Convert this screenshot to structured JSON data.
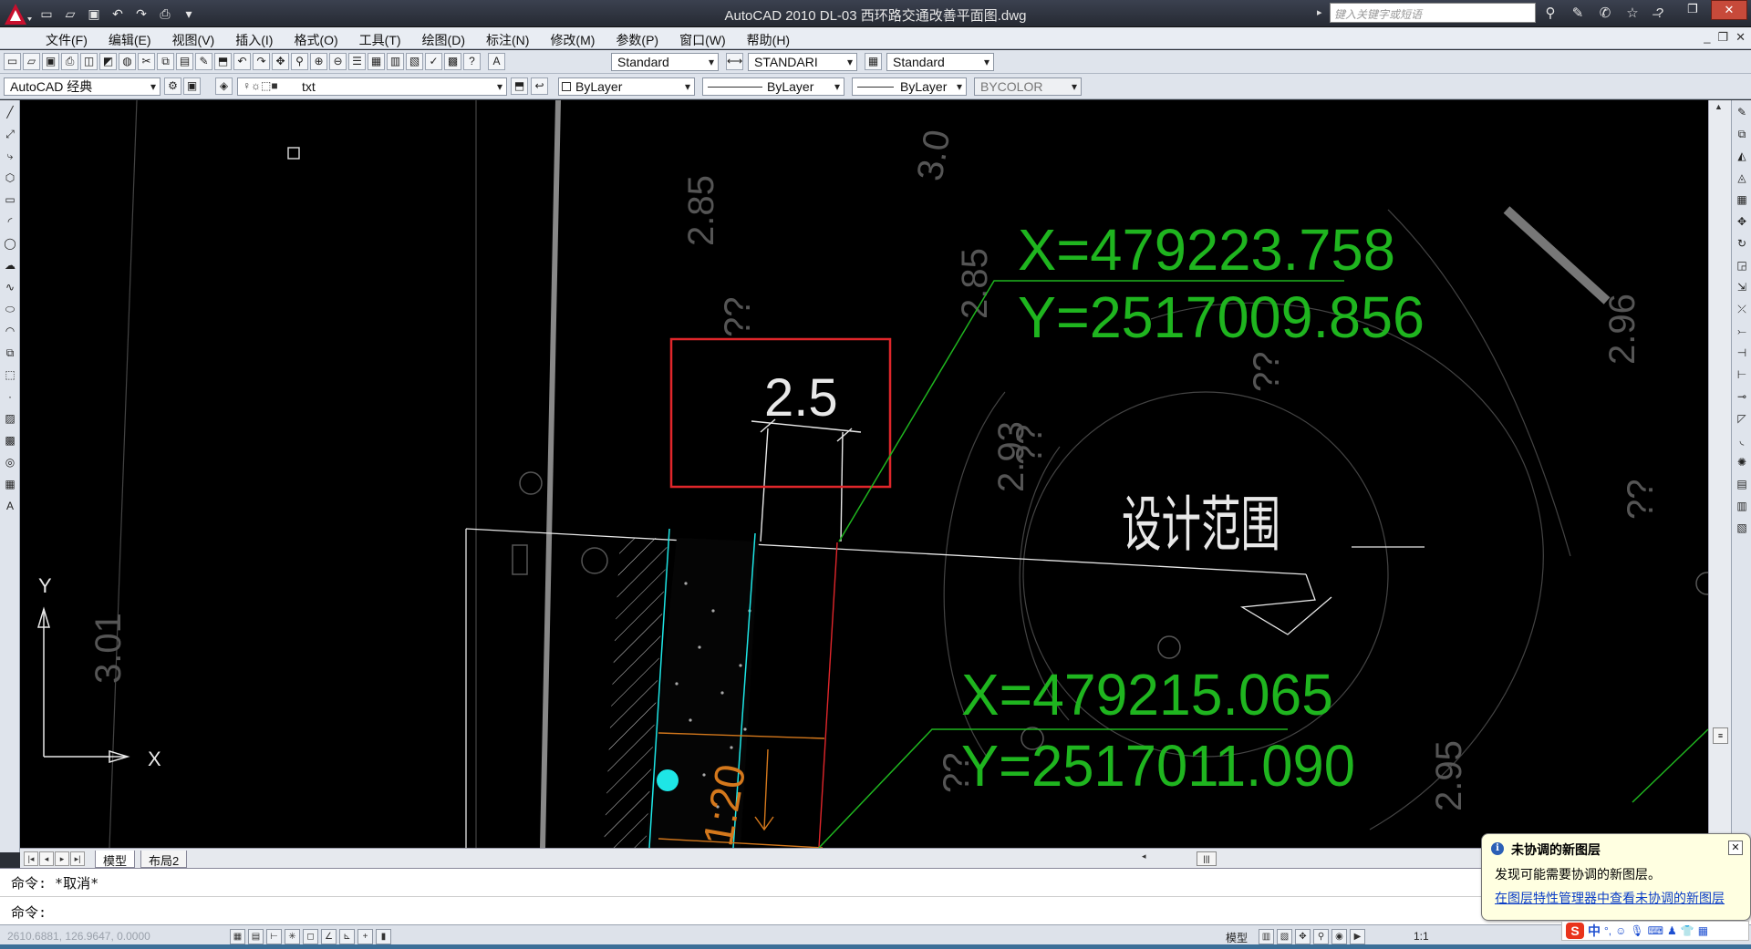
{
  "window": {
    "title": "AutoCAD 2010    DL-03 西环路交通改善平面图.dwg",
    "search_placeholder": "键入关键字或短语"
  },
  "menu": {
    "items": [
      "文件(F)",
      "编辑(E)",
      "视图(V)",
      "插入(I)",
      "格式(O)",
      "工具(T)",
      "绘图(D)",
      "标注(N)",
      "修改(M)",
      "参数(P)",
      "窗口(W)",
      "帮助(H)"
    ]
  },
  "toolbar": {
    "text_style": "Standard",
    "dim_style": "STANDARI",
    "table_style": "Standard",
    "workspace": "AutoCAD 经典",
    "layer": "txt",
    "color": "ByLayer",
    "linetype": "ByLayer",
    "lineweight": "ByLayer",
    "plotstyle": "BYCOLOR"
  },
  "drawing": {
    "label_25": "2.5",
    "design_range": "设计范围",
    "coord1_x": "X=479223.758",
    "coord1_y": "Y=2517009.856",
    "coord2_x": "X=479215.065",
    "coord2_y": "Y=2517011.090",
    "ucs_x": "X",
    "ucs_y": "Y",
    "slope": "1:20",
    "elev_labels": [
      "2.85",
      "3.0",
      "2.85",
      "2.96",
      "2.93",
      "3.01",
      "2.95",
      "??",
      "??",
      "??",
      "??",
      "??"
    ]
  },
  "tabs": {
    "items": [
      "模型",
      "布局2"
    ]
  },
  "command": {
    "line1": "命令: *取消*",
    "line2": "命令:"
  },
  "status": {
    "coords": "2610.6881, 126.9647, 0.0000",
    "model_label": "模型",
    "scale_label": "1:1"
  },
  "notification": {
    "title": "未协调的新图层",
    "message": "发现可能需要协调的新图层。",
    "link": "在图层特性管理器中查看未协调的新图层"
  },
  "ime": {
    "lang": "中"
  },
  "colors": {
    "green_text": "#1fb51f",
    "red_highlight": "#e0262b",
    "cyan": "#1ee6e6",
    "orange": "#d4781c"
  }
}
